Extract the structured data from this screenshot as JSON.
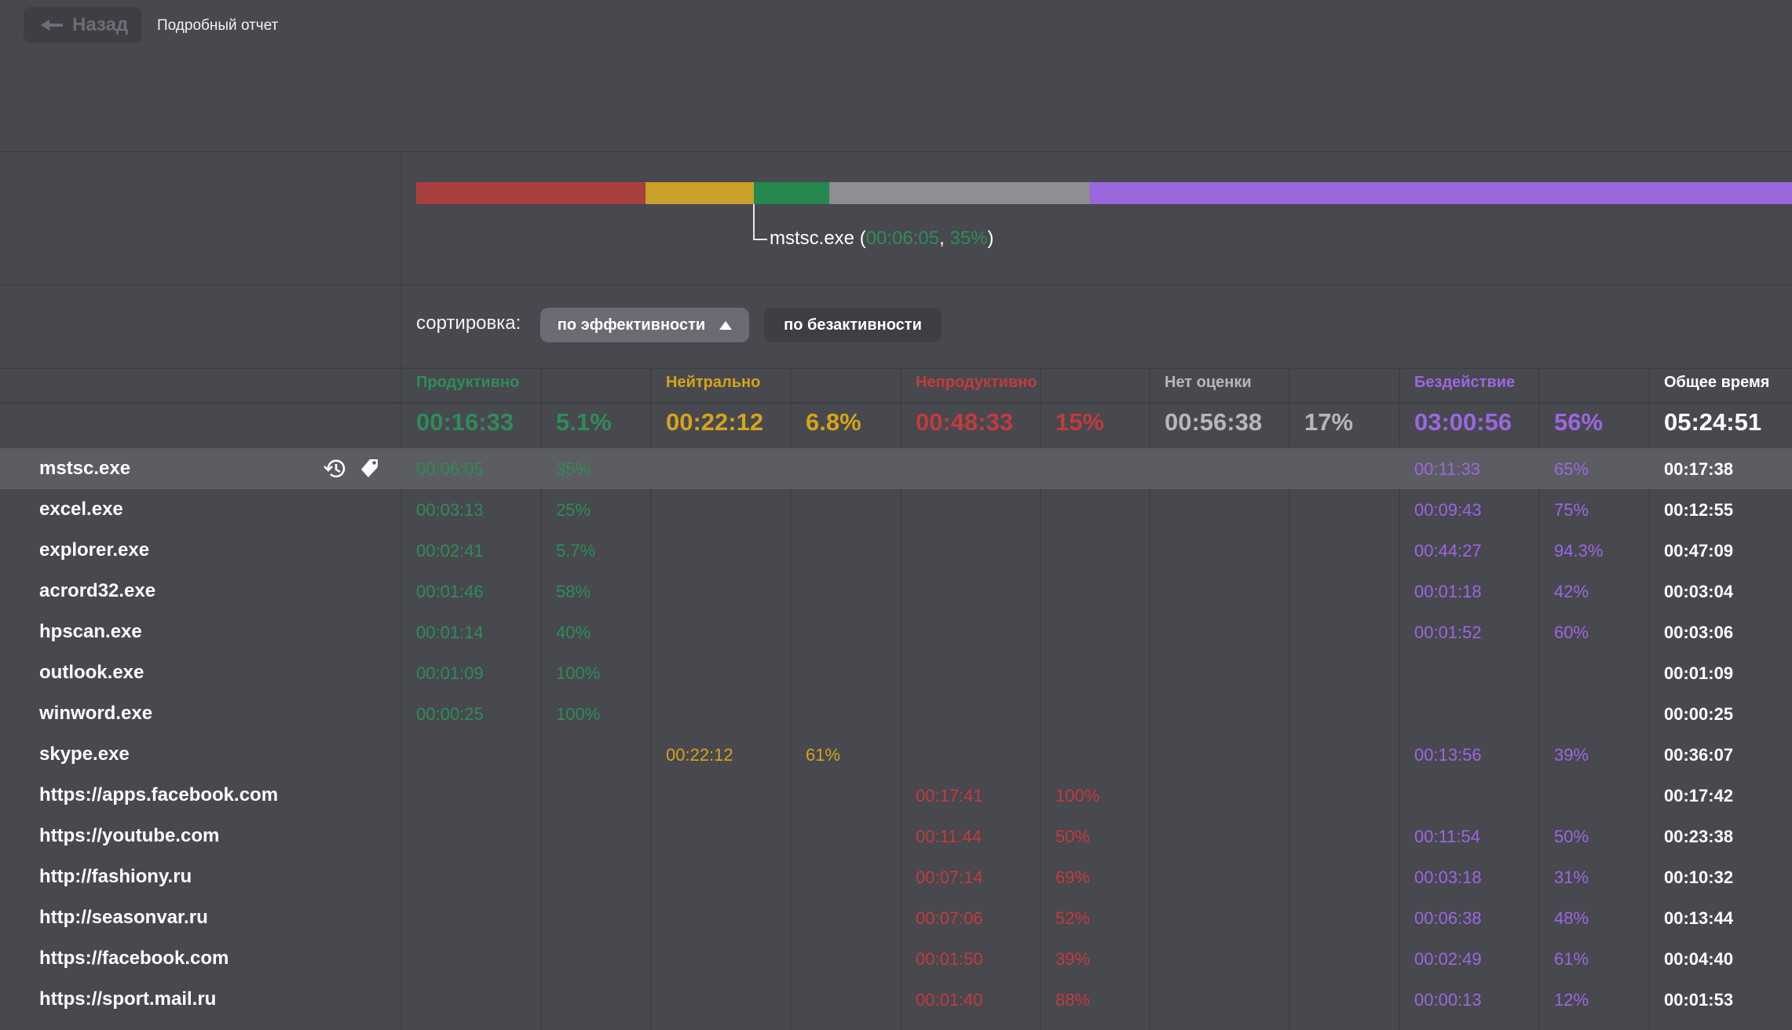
{
  "header": {
    "back_label": "Назад",
    "title": "Подробный отчет"
  },
  "colors": {
    "productive": "#2d8d57",
    "neutral": "#d6a418",
    "unproductive": "#c23b3b",
    "unrated": "#b6b6bb",
    "idle": "#9b67e0",
    "bar_unproductive": "#a8403f",
    "bar_neutral": "#c9a128",
    "bar_productive": "#24884f",
    "bar_unrated": "#8e8e93",
    "bar_idle": "#9b67dc"
  },
  "tooltip": {
    "app": "mstsc.exe (",
    "time": "00:06:05",
    "sep": ", ",
    "pct": "35%",
    "close": ")"
  },
  "sort": {
    "label": "сортировка:",
    "by_efficiency": "по эффективности",
    "by_inactivity": "по безактивности"
  },
  "categories": {
    "productive": {
      "label": "Продуктивно",
      "time": "00:16:33",
      "pct": "5.1%"
    },
    "neutral": {
      "label": "Нейтрально",
      "time": "00:22:12",
      "pct": "6.8%"
    },
    "unproductive": {
      "label": "Непродуктивно",
      "time": "00:48:33",
      "pct": "15%"
    },
    "unrated": {
      "label": "Нет оценки",
      "time": "00:56:38",
      "pct": "17%"
    },
    "idle": {
      "label": "Бездействие",
      "time": "03:00:56",
      "pct": "56%"
    },
    "total": {
      "label": "Общее время",
      "time": "05:24:51"
    }
  },
  "rows": [
    {
      "name": "mstsc.exe",
      "prod_time": "00:06:05",
      "prod_pct": "35%",
      "neu_time": "",
      "neu_pct": "",
      "unp_time": "",
      "unp_pct": "",
      "none_time": "",
      "none_pct": "",
      "idle_time": "00:11:33",
      "idle_pct": "65%",
      "total": "00:17:38"
    },
    {
      "name": "excel.exe",
      "prod_time": "00:03:13",
      "prod_pct": "25%",
      "neu_time": "",
      "neu_pct": "",
      "unp_time": "",
      "unp_pct": "",
      "none_time": "",
      "none_pct": "",
      "idle_time": "00:09:43",
      "idle_pct": "75%",
      "total": "00:12:55"
    },
    {
      "name": "explorer.exe",
      "prod_time": "00:02:41",
      "prod_pct": "5.7%",
      "neu_time": "",
      "neu_pct": "",
      "unp_time": "",
      "unp_pct": "",
      "none_time": "",
      "none_pct": "",
      "idle_time": "00:44:27",
      "idle_pct": "94.3%",
      "total": "00:47:09"
    },
    {
      "name": "acrord32.exe",
      "prod_time": "00:01:46",
      "prod_pct": "58%",
      "neu_time": "",
      "neu_pct": "",
      "unp_time": "",
      "unp_pct": "",
      "none_time": "",
      "none_pct": "",
      "idle_time": "00:01:18",
      "idle_pct": "42%",
      "total": "00:03:04"
    },
    {
      "name": "hpscan.exe",
      "prod_time": "00:01:14",
      "prod_pct": "40%",
      "neu_time": "",
      "neu_pct": "",
      "unp_time": "",
      "unp_pct": "",
      "none_time": "",
      "none_pct": "",
      "idle_time": "00:01:52",
      "idle_pct": "60%",
      "total": "00:03:06"
    },
    {
      "name": "outlook.exe",
      "prod_time": "00:01:09",
      "prod_pct": "100%",
      "neu_time": "",
      "neu_pct": "",
      "unp_time": "",
      "unp_pct": "",
      "none_time": "",
      "none_pct": "",
      "idle_time": "",
      "idle_pct": "",
      "total": "00:01:09"
    },
    {
      "name": "winword.exe",
      "prod_time": "00:00:25",
      "prod_pct": "100%",
      "neu_time": "",
      "neu_pct": "",
      "unp_time": "",
      "unp_pct": "",
      "none_time": "",
      "none_pct": "",
      "idle_time": "",
      "idle_pct": "",
      "total": "00:00:25"
    },
    {
      "name": "skype.exe",
      "prod_time": "",
      "prod_pct": "",
      "neu_time": "00:22:12",
      "neu_pct": "61%",
      "unp_time": "",
      "unp_pct": "",
      "none_time": "",
      "none_pct": "",
      "idle_time": "00:13:56",
      "idle_pct": "39%",
      "total": "00:36:07"
    },
    {
      "name": "https://apps.facebook.com",
      "prod_time": "",
      "prod_pct": "",
      "neu_time": "",
      "neu_pct": "",
      "unp_time": "00:17:41",
      "unp_pct": "100%",
      "none_time": "",
      "none_pct": "",
      "idle_time": "",
      "idle_pct": "",
      "total": "00:17:42"
    },
    {
      "name": "https://youtube.com",
      "prod_time": "",
      "prod_pct": "",
      "neu_time": "",
      "neu_pct": "",
      "unp_time": "00:11:44",
      "unp_pct": "50%",
      "none_time": "",
      "none_pct": "",
      "idle_time": "00:11:54",
      "idle_pct": "50%",
      "total": "00:23:38"
    },
    {
      "name": "http://fashiony.ru",
      "prod_time": "",
      "prod_pct": "",
      "neu_time": "",
      "neu_pct": "",
      "unp_time": "00:07:14",
      "unp_pct": "69%",
      "none_time": "",
      "none_pct": "",
      "idle_time": "00:03:18",
      "idle_pct": "31%",
      "total": "00:10:32"
    },
    {
      "name": "http://seasonvar.ru",
      "prod_time": "",
      "prod_pct": "",
      "neu_time": "",
      "neu_pct": "",
      "unp_time": "00:07:06",
      "unp_pct": "52%",
      "none_time": "",
      "none_pct": "",
      "idle_time": "00:06:38",
      "idle_pct": "48%",
      "total": "00:13:44"
    },
    {
      "name": "https://facebook.com",
      "prod_time": "",
      "prod_pct": "",
      "neu_time": "",
      "neu_pct": "",
      "unp_time": "00:01:50",
      "unp_pct": "39%",
      "none_time": "",
      "none_pct": "",
      "idle_time": "00:02:49",
      "idle_pct": "61%",
      "total": "00:04:40"
    },
    {
      "name": "https://sport.mail.ru",
      "prod_time": "",
      "prod_pct": "",
      "neu_time": "",
      "neu_pct": "",
      "unp_time": "00:01:40",
      "unp_pct": "88%",
      "none_time": "",
      "none_pct": "",
      "idle_time": "00:00:13",
      "idle_pct": "12%",
      "total": "00:01:53"
    }
  ]
}
